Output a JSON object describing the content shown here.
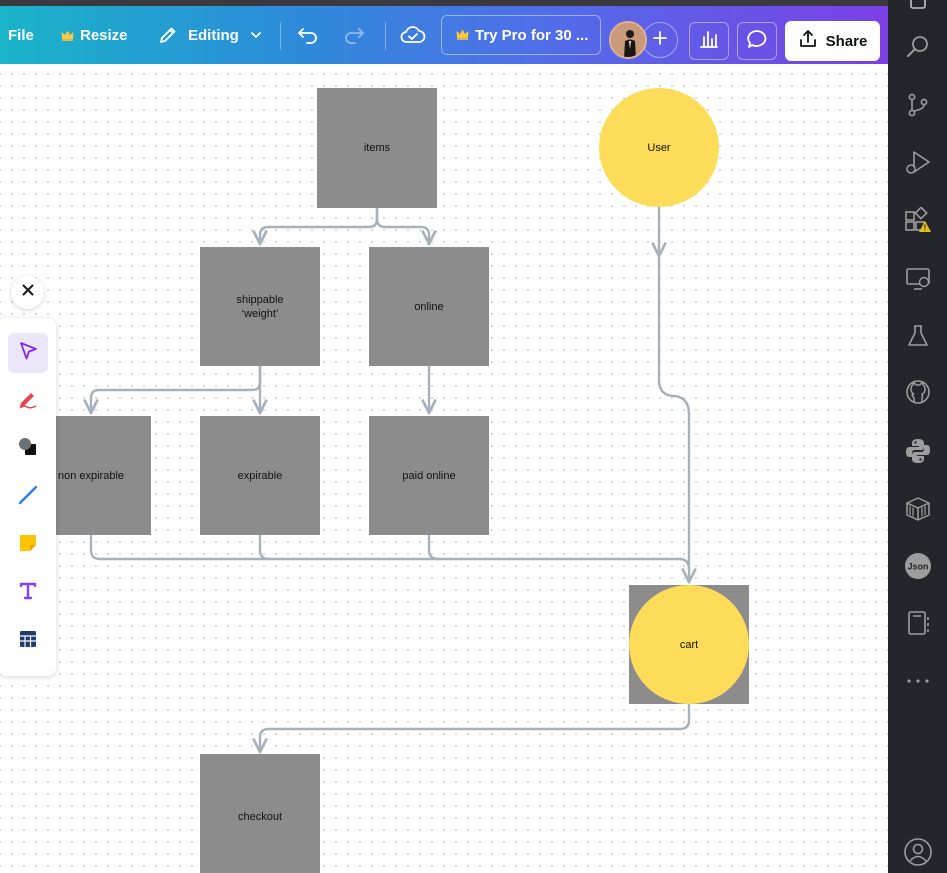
{
  "toolbar": {
    "file_label": "File",
    "resize_label": "Resize",
    "editing_label": "Editing",
    "pro_label": "Try Pro for 30 ...",
    "share_label": "Share"
  },
  "diagram": {
    "nodes": {
      "items": "items",
      "shippable": "shippable",
      "shippable_sub": "‘weight’",
      "online": "online",
      "non_expirable": "non expirable",
      "expirable": "expirable",
      "paid_online": "paid online",
      "user": "User",
      "cart": "cart",
      "checkout": "checkout"
    }
  },
  "tools": [
    "select-icon",
    "draw-icon",
    "shapes-icon",
    "line-icon",
    "sticky-note-icon",
    "text-icon",
    "table-icon"
  ],
  "activity_bar": [
    "explorer-icon",
    "search-icon",
    "source-control-icon",
    "run-debug-icon",
    "extensions-icon",
    "remote-explorer-icon",
    "testing-icon",
    "github-icon",
    "python-icon",
    "containers-icon",
    "json-icon",
    "notebook-icon",
    "more-icon",
    "account-icon"
  ],
  "colors": {
    "rect_fill": "#8c8c8c",
    "circle_fill": "#fddc5a",
    "connector": "#a6b1bb",
    "accent": "#7d2ae8"
  }
}
